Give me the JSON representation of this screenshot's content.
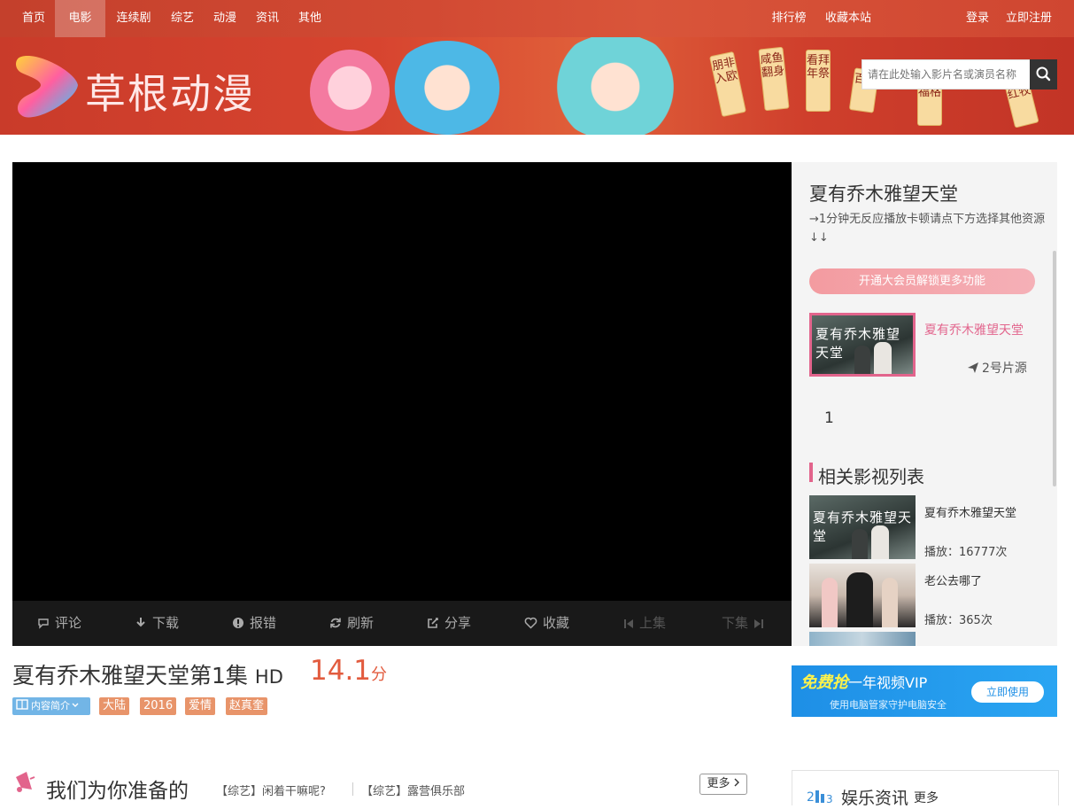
{
  "nav": {
    "items": [
      "首页",
      "电影",
      "连续剧",
      "综艺",
      "动漫",
      "资讯",
      "其他"
    ],
    "right": [
      "排行榜",
      "收藏本站"
    ],
    "login": "登录",
    "register": "立即注册"
  },
  "logo": {
    "text": "草根动漫"
  },
  "banner_tags": [
    "朋非入欧",
    "咸鱼翻身",
    "看拜年祭",
    "百万",
    "福格",
    "红牧"
  ],
  "search": {
    "placeholder": "请在此处输入影片名或演员名称"
  },
  "toolbar": {
    "comment": "评论",
    "download": "下载",
    "report": "报错",
    "refresh": "刷新",
    "share": "分享",
    "favorite": "收藏",
    "prev": "上集",
    "next": "下集"
  },
  "sidebar": {
    "title": "夏有乔木雅望天堂",
    "notice": "→1分钟无反应播放卡顿请点下方选择其他资源↓↓",
    "vip_button": "开通大会员解锁更多功能",
    "source": {
      "title": "夏有乔木雅望天堂",
      "label": "2号片源",
      "thumb_text": "夏有乔木雅望天堂"
    },
    "episode": "1",
    "related_title": "相关影视列表",
    "related": [
      {
        "name": "夏有乔木雅望天堂",
        "plays": "播放：16777次",
        "thumb_text": "夏有乔木雅望天堂"
      },
      {
        "name": "老公去哪了",
        "plays": "播放：365次"
      }
    ]
  },
  "movie": {
    "title": "夏有乔木雅望天堂第1集",
    "quality": "HD",
    "score": "14.1",
    "score_unit": "分",
    "tags": [
      "内容简介",
      "大陆",
      "2016",
      "爱情",
      "赵真奎"
    ]
  },
  "ad": {
    "main": "免费抢",
    "main_sub": "一年视频VIP",
    "sub": "使用电脑管家守护电脑安全",
    "button": "立即使用"
  },
  "recommend": {
    "title": "我们为你准备的",
    "links": [
      "【综艺】闲着干嘛呢?",
      "【综艺】露营俱乐部"
    ],
    "more": "更多"
  },
  "news": {
    "title": "娱乐资讯",
    "more": "更多"
  },
  "colors": {
    "accent": "#e2648c",
    "score": "#e25b3e",
    "nav": "#c4402c",
    "tag": "#e8946a"
  }
}
